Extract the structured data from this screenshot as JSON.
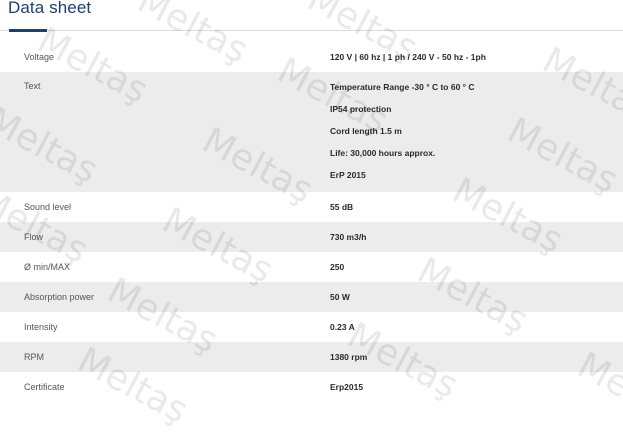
{
  "section": {
    "title": "Data sheet"
  },
  "specs": [
    {
      "key": "Voltage",
      "values": [
        "120 V | 60 hz | 1 ph / 240 V - 50 hz - 1ph"
      ]
    },
    {
      "key": "Text",
      "values": [
        "Temperature Range -30 ° C to 60 ° C",
        "IP54 protection",
        "Cord length 1.5 m",
        "Life: 30,000 hours approx.",
        "ErP 2015"
      ]
    },
    {
      "key": "Sound level",
      "values": [
        "55 dB"
      ]
    },
    {
      "key": "Flow",
      "values": [
        "730 m3/h"
      ]
    },
    {
      "key": "Ø min/MAX",
      "values": [
        "250"
      ]
    },
    {
      "key": "Absorption power",
      "values": [
        "50 W"
      ]
    },
    {
      "key": "Intensity",
      "values": [
        "0.23 A"
      ]
    },
    {
      "key": "RPM",
      "values": [
        "1380 rpm"
      ]
    },
    {
      "key": "Certificate",
      "values": [
        "Erp2015"
      ]
    }
  ],
  "watermark": {
    "text": "Meltaş"
  }
}
